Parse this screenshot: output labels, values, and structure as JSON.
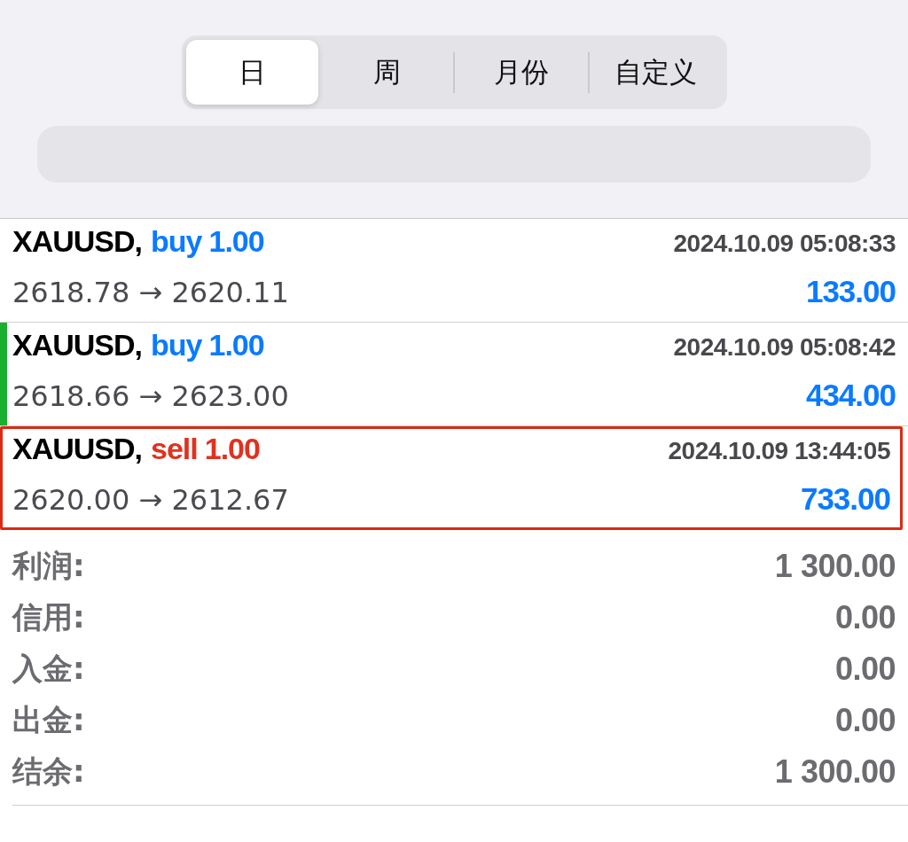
{
  "tabs": [
    {
      "label": "日",
      "selected": true
    },
    {
      "label": "周",
      "selected": false
    },
    {
      "label": "月份",
      "selected": false
    },
    {
      "label": "自定义",
      "selected": false
    }
  ],
  "deals": [
    {
      "symbol": "XAUUSD,",
      "type": "buy",
      "volume": "1.00",
      "time": "2024.10.09 05:08:33",
      "prices": "2618.78 → 2620.11",
      "profit": "133.00",
      "marked": false,
      "highlighted": false
    },
    {
      "symbol": "XAUUSD,",
      "type": "buy",
      "volume": "1.00",
      "time": "2024.10.09 05:08:42",
      "prices": "2618.66 → 2623.00",
      "profit": "434.00",
      "marked": true,
      "highlighted": false
    },
    {
      "symbol": "XAUUSD,",
      "type": "sell",
      "volume": "1.00",
      "time": "2024.10.09 13:44:05",
      "prices": "2620.00 → 2612.67",
      "profit": "733.00",
      "marked": false,
      "highlighted": true
    }
  ],
  "summary": [
    {
      "label": "利润:",
      "value": "1 300.00"
    },
    {
      "label": "信用:",
      "value": "0.00"
    },
    {
      "label": "入金:",
      "value": "0.00"
    },
    {
      "label": "出金:",
      "value": "0.00"
    },
    {
      "label": "结余:",
      "value": "1 300.00"
    }
  ]
}
